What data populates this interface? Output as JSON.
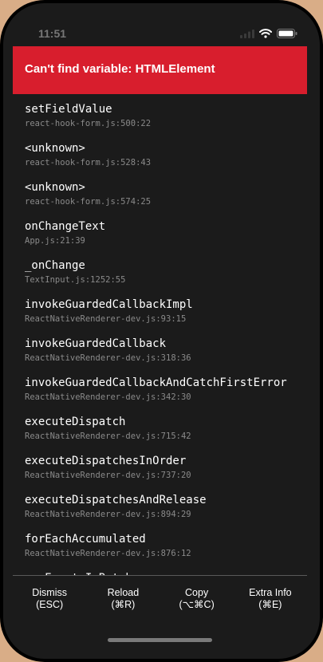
{
  "status_bar": {
    "time": "11:51"
  },
  "error": {
    "title": "Can't find variable: HTMLElement"
  },
  "stack": [
    {
      "name": "setFieldValue",
      "location": "react-hook-form.js:500:22"
    },
    {
      "name": "<unknown>",
      "location": "react-hook-form.js:528:43"
    },
    {
      "name": "<unknown>",
      "location": "react-hook-form.js:574:25"
    },
    {
      "name": "onChangeText",
      "location": "App.js:21:39"
    },
    {
      "name": "_onChange",
      "location": "TextInput.js:1252:55"
    },
    {
      "name": "invokeGuardedCallbackImpl",
      "location": "ReactNativeRenderer-dev.js:93:15"
    },
    {
      "name": "invokeGuardedCallback",
      "location": "ReactNativeRenderer-dev.js:318:36"
    },
    {
      "name": "invokeGuardedCallbackAndCatchFirstError",
      "location": "ReactNativeRenderer-dev.js:342:30"
    },
    {
      "name": "executeDispatch",
      "location": "ReactNativeRenderer-dev.js:715:42"
    },
    {
      "name": "executeDispatchesInOrder",
      "location": "ReactNativeRenderer-dev.js:737:20"
    },
    {
      "name": "executeDispatchesAndRelease",
      "location": "ReactNativeRenderer-dev.js:894:29"
    },
    {
      "name": "forEachAccumulated",
      "location": "ReactNativeRenderer-dev.js:876:12"
    },
    {
      "name": "runEventsInBatch",
      "location": ""
    }
  ],
  "toolbar": {
    "dismiss": {
      "label": "Dismiss",
      "shortcut": "(ESC)"
    },
    "reload": {
      "label": "Reload",
      "shortcut": "(⌘R)"
    },
    "copy": {
      "label": "Copy",
      "shortcut": "(⌥⌘C)"
    },
    "extra": {
      "label": "Extra Info",
      "shortcut": "(⌘E)"
    }
  }
}
